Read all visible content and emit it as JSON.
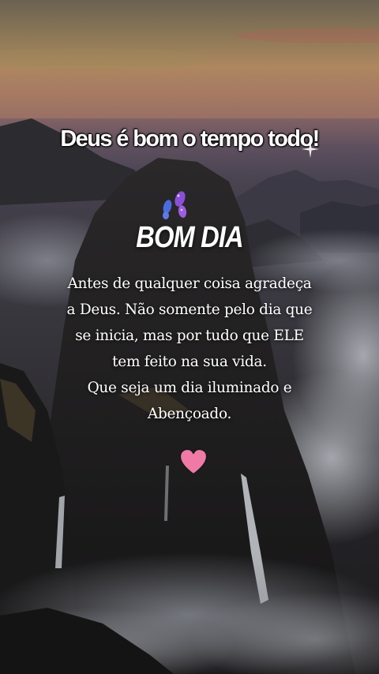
{
  "headline": "Deus é bom o tempo todo!",
  "greeting": "BOM DIA",
  "message_lines": [
    "Antes de qualquer coisa agradeça",
    "a Deus. Não somente pelo dia que",
    "se inicia, mas por tudo que ELE",
    "tem feito na sua vida.",
    "Que seja um dia iluminado e",
    "Abençoado."
  ],
  "icons": {
    "sparkle": "sparkle-icon",
    "butterfly": "butterfly-icon",
    "heart": "heart-icon"
  },
  "colors": {
    "heart": "#f07aa6",
    "butterfly_purple": "#8a4fd6",
    "butterfly_blue": "#4a6ce0",
    "text": "#ffffff"
  }
}
